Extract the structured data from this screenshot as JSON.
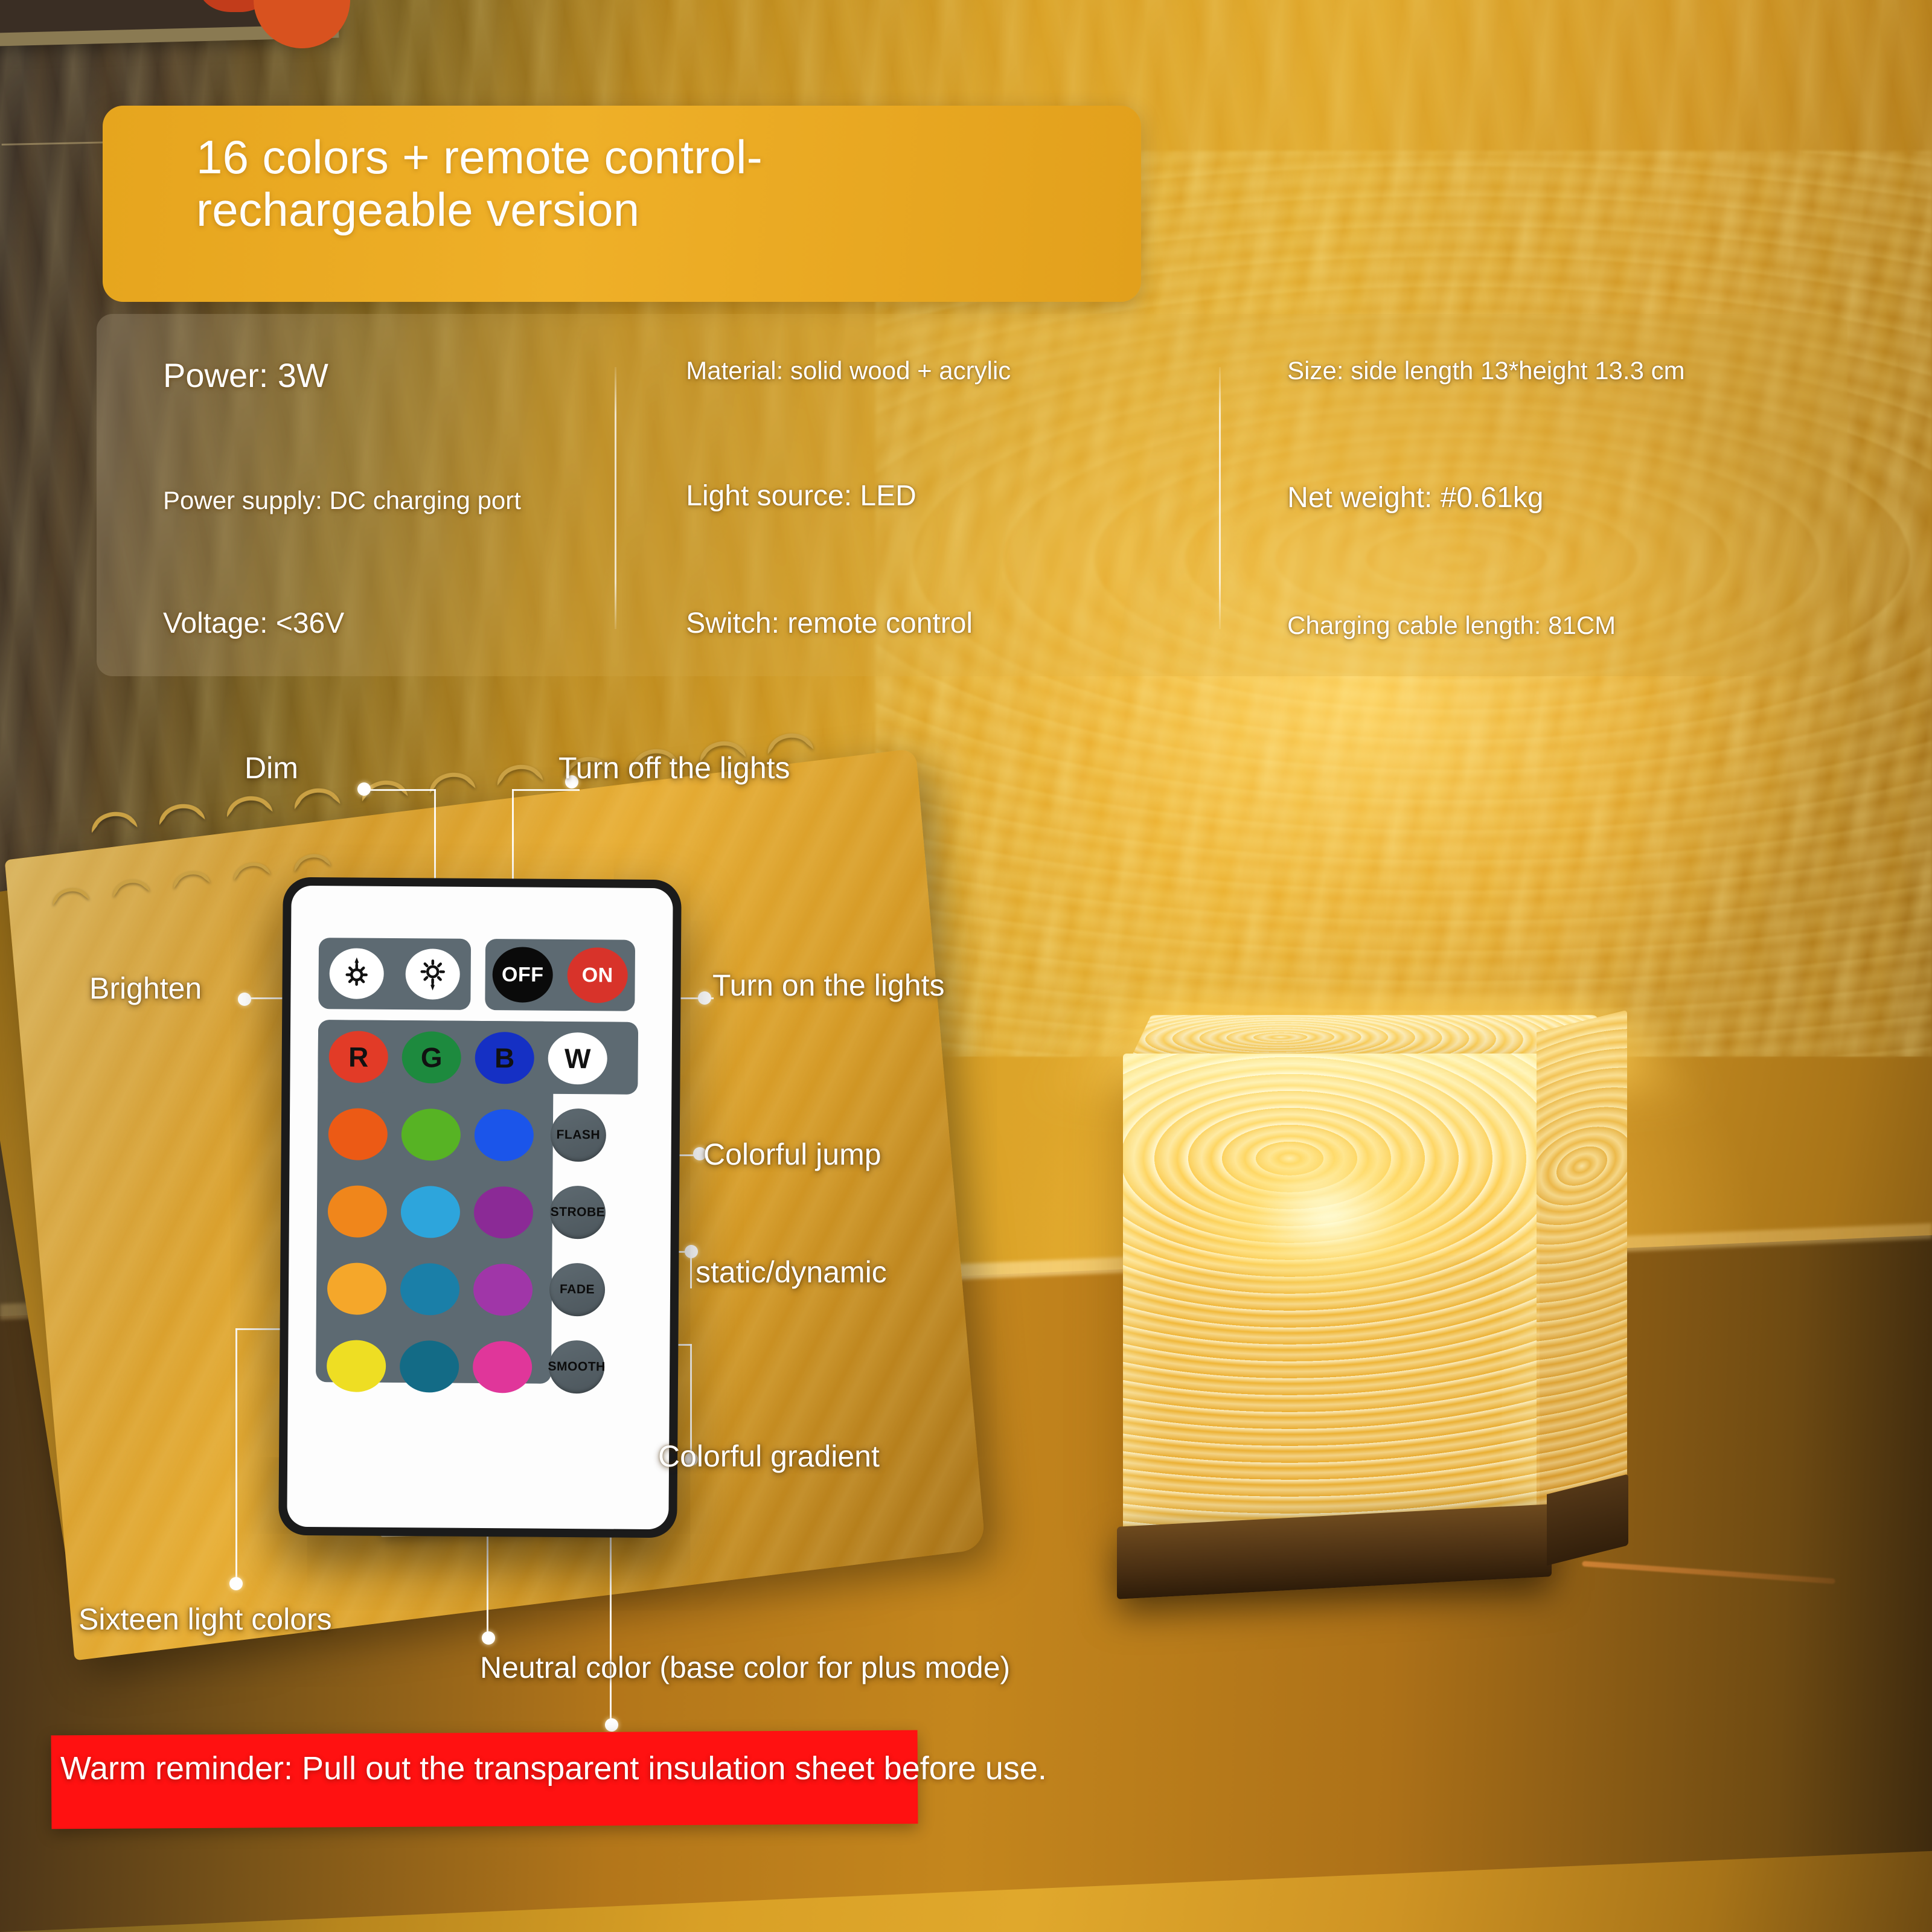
{
  "title_banner": {
    "text": "16 colors + remote control-\nrechargeable version",
    "bg_color": "#e6a51e"
  },
  "spec_panel": {
    "columns": [
      {
        "items": [
          {
            "text": "Power: 3W",
            "size": "big"
          },
          {
            "text": "Power supply: DC charging port",
            "size": "small"
          },
          {
            "text": "Voltage: <36V",
            "size": "mid"
          }
        ]
      },
      {
        "items": [
          {
            "text": "Material: solid wood + acrylic",
            "size": "small"
          },
          {
            "text": "Light source: LED",
            "size": "mid"
          },
          {
            "text": "Switch: remote control",
            "size": "mid"
          }
        ]
      },
      {
        "items": [
          {
            "text": "Size: side length 13*height 13.3 cm",
            "size": "small"
          },
          {
            "text": "Net weight: #0.61kg",
            "size": "mid"
          },
          {
            "text": "Charging cable length: 81CM",
            "size": "small"
          }
        ]
      }
    ]
  },
  "remote": {
    "dim_group": [
      {
        "name": "dim-button",
        "icon": "sun-decrease-icon"
      },
      {
        "name": "brighten-button",
        "icon": "sun-increase-icon"
      }
    ],
    "power_group": [
      {
        "label": "OFF",
        "color": "#0a0a0a"
      },
      {
        "label": "ON",
        "color": "#d8332a"
      }
    ],
    "rgbw_row": [
      {
        "label": "R",
        "color": "#e23b27"
      },
      {
        "label": "G",
        "color": "#1d8a3e"
      },
      {
        "label": "B",
        "color": "#1530c4"
      },
      {
        "label": "W",
        "color": "#ffffff"
      }
    ],
    "color_grid": [
      [
        "#ec5a15",
        "#57b324",
        "#1b55ea"
      ],
      [
        "#f0861b",
        "#2da5dc",
        "#8b2a96"
      ],
      [
        "#f5a72a",
        "#1a7fa8",
        "#a036a8"
      ],
      [
        "#eede23",
        "#136b86",
        "#e0369a"
      ]
    ],
    "mode_buttons": [
      "FLASH",
      "STROBE",
      "FADE",
      "SMOOTH"
    ],
    "pad_color": "#5d6a72",
    "body_color": "#1b1b1b",
    "face_color": "#fdfdfd"
  },
  "callouts": {
    "dim": "Dim",
    "turn_off": "Turn off the lights",
    "brighten": "Brighten",
    "turn_on": "Turn on the lights",
    "colorful_jump": "Colorful jump",
    "static_dynamic": "static/dynamic",
    "colorful_gradient": "Colorful gradient",
    "sixteen_colors": "Sixteen light colors",
    "neutral_color": "Neutral color (base color for plus mode)"
  },
  "warning": {
    "text": "Warm reminder: Pull out the transparent insulation sheet before use.",
    "bar_color": "#ff1111"
  }
}
